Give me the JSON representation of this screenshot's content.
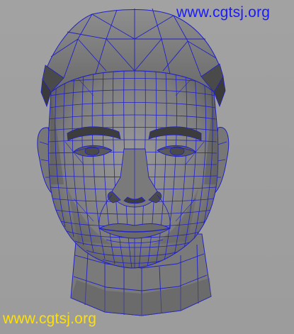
{
  "watermark_top": "www.cgtsj.org",
  "watermark_bottom": "www.cgtsj.org",
  "colors": {
    "background": "#a0a0a0",
    "wireframe": "#2020c8",
    "watermark_top": "#1a1aff",
    "watermark_bottom": "#ffe000"
  },
  "model": {
    "subject": "polygonal head mesh, front view, wireframe on shaded"
  }
}
